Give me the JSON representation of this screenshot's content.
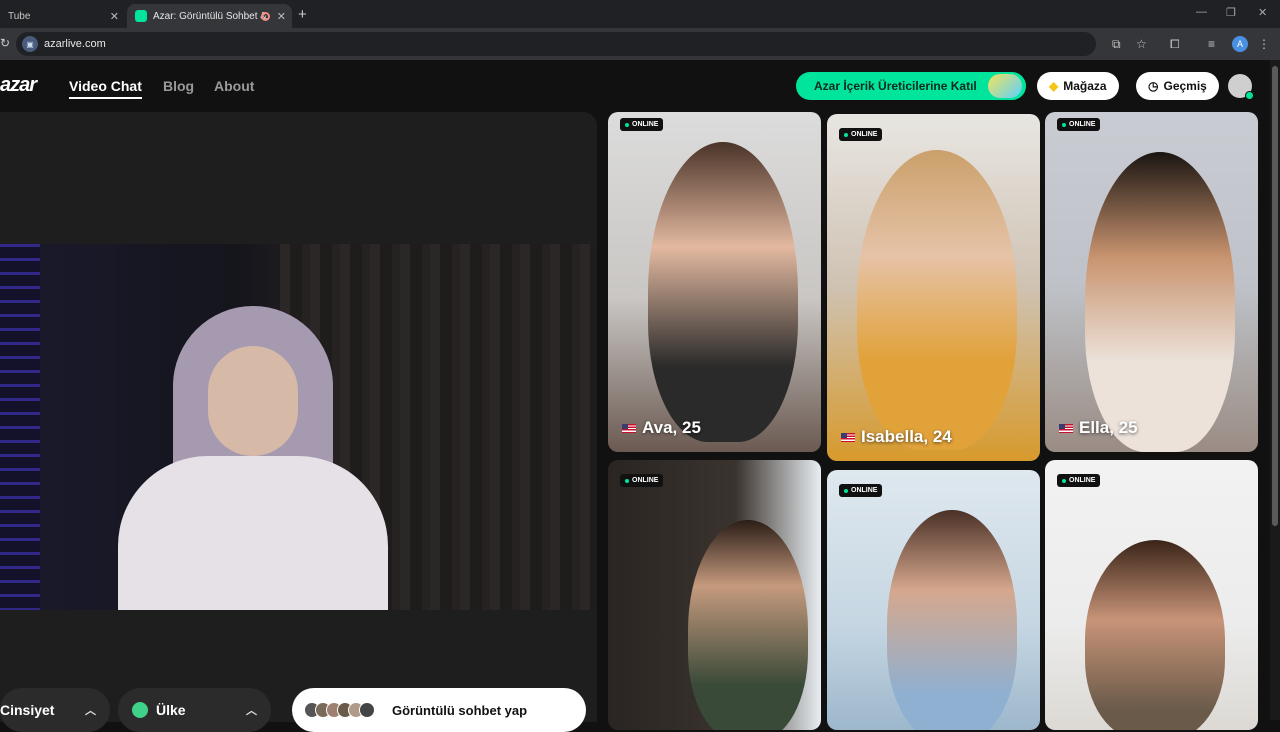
{
  "browser": {
    "tabs": [
      {
        "title": "Tube"
      },
      {
        "title": "Azar: Görüntülü Sohbet & "
      }
    ],
    "url": "azarlive.com",
    "profile_initial": "A"
  },
  "site": {
    "logo": "azar",
    "nav": [
      {
        "label": "Video Chat",
        "active": true
      },
      {
        "label": "Blog",
        "active": false
      },
      {
        "label": "About",
        "active": false
      }
    ],
    "cta_label": "Azar İçerik Üreticilerine Katıl",
    "store_label": "Mağaza",
    "history_label": "Geçmiş"
  },
  "controls": {
    "gender_label": "Cinsiyet",
    "country_label": "Ülke",
    "start_label": "Görüntülü sohbet yap"
  },
  "cards": [
    {
      "badge": "ONLINE",
      "name": "Ava, 25",
      "country": "US"
    },
    {
      "badge": "ONLINE",
      "name": "Isabella, 24",
      "country": "US"
    },
    {
      "badge": "ONLINE",
      "name": "Ella, 25",
      "country": "US"
    },
    {
      "badge": "ONLINE",
      "name": "",
      "country": ""
    },
    {
      "badge": "ONLINE",
      "name": "",
      "country": ""
    },
    {
      "badge": "ONLINE",
      "name": "",
      "country": ""
    }
  ],
  "colors": {
    "accent": "#00e59b",
    "background": "#111111",
    "panel": "#1e1e1e"
  }
}
